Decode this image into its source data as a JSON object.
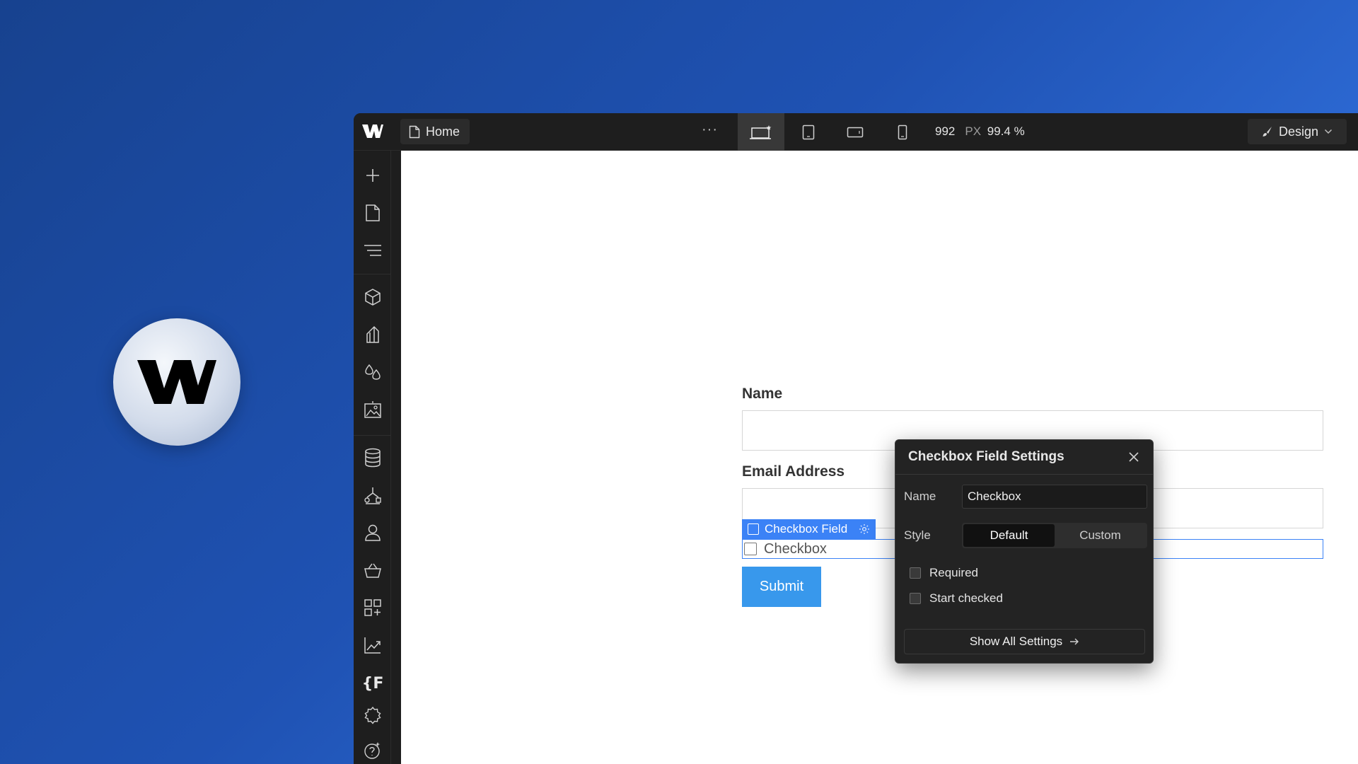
{
  "topbar": {
    "page_tab": "Home",
    "more": "···",
    "width_value": "992",
    "width_unit": "PX",
    "zoom": "99.4 %",
    "mode_button": "Design"
  },
  "sidebar": {
    "icons": [
      "plus-icon",
      "pages-icon",
      "navigator-icon",
      "components-icon",
      "styles-icon",
      "variables-icon",
      "assets-icon",
      "cms-icon",
      "logic-icon",
      "users-icon",
      "ecommerce-icon",
      "apps-icon",
      "analyze-icon",
      "code-icon",
      "settings-icon",
      "help-icon"
    ]
  },
  "canvas": {
    "name_label": "Name",
    "email_label": "Email Address",
    "checkbox_tag": "Checkbox Field",
    "checkbox_label": "Checkbox",
    "submit_label": "Submit"
  },
  "popup": {
    "title": "Checkbox Field Settings",
    "name_label": "Name",
    "name_value": "Checkbox",
    "style_label": "Style",
    "style_options": [
      "Default",
      "Custom"
    ],
    "style_selected": "Default",
    "required_label": "Required",
    "required_checked": false,
    "start_checked_label": "Start checked",
    "start_checked_checked": false,
    "show_all": "Show All Settings"
  },
  "colors": {
    "accent": "#3b82f6",
    "submit": "#3898ec",
    "panel": "#1e1e1e"
  }
}
